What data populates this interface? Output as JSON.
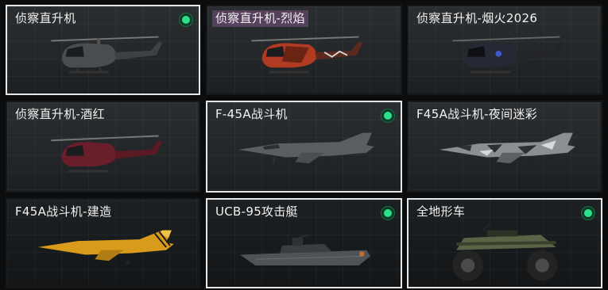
{
  "items": [
    {
      "name": "侦察直升机",
      "owned": true
    },
    {
      "name": "侦察直升机-烈焰",
      "owned": false
    },
    {
      "name": "侦察直升机-烟火2026",
      "owned": false
    },
    {
      "name": "侦察直升机-酒红",
      "owned": false
    },
    {
      "name": "F-45A战斗机",
      "owned": true
    },
    {
      "name": "F45A战斗机-夜间迷彩",
      "owned": false
    },
    {
      "name": "F45A战斗机-建造",
      "owned": false
    },
    {
      "name": "UCB-95攻击艇",
      "owned": true
    },
    {
      "name": "全地形车",
      "owned": true
    }
  ],
  "colors": {
    "owned_indicator": "#2fe08a",
    "selected_border": "#e6e6e6",
    "heli_default": "#4a4d50",
    "heli_flame": "#b03a22",
    "heli_firework": "#262833",
    "heli_wine": "#6a1d2a",
    "jet_default": "#5a5e62",
    "jet_camo": "#8a8f94",
    "jet_build": "#d89b1c",
    "boat": "#4e5357",
    "atv": "#5b6346"
  }
}
